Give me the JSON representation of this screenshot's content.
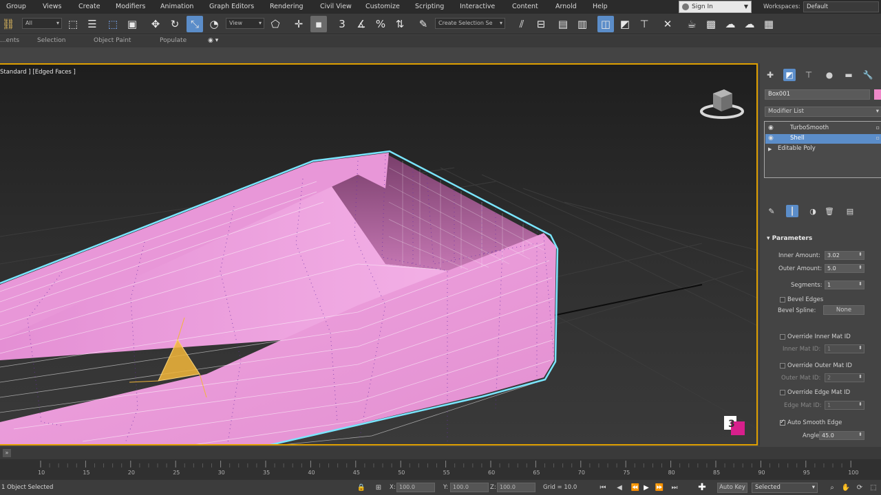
{
  "menu": {
    "items": [
      "Group",
      "Views",
      "Create",
      "Modifiers",
      "Animation",
      "Graph Editors",
      "Rendering",
      "Civil View",
      "Customize",
      "Scripting",
      "Interactive",
      "Content",
      "Arnold",
      "Help"
    ],
    "signin": "Sign In",
    "workspaces_label": "Workspaces:",
    "workspace_value": "Default"
  },
  "toolbar": {
    "filter_dropdown": "All",
    "ref_coord_dropdown": "View",
    "snap_label": "3",
    "named_selection": "Create Selection Se"
  },
  "ribbon": {
    "tabs": [
      "...ents",
      "Selection",
      "Object Paint",
      "Populate"
    ]
  },
  "viewport": {
    "label": "Standard ] [Edged Faces ]"
  },
  "command_panel": {
    "object_name": "Box001",
    "object_color": "#ee88c8",
    "modifier_list": "Modifier List",
    "stack": [
      {
        "label": "TurboSmooth",
        "selected": false
      },
      {
        "label": "Shell",
        "selected": true
      },
      {
        "label": "Editable Poly",
        "selected": false
      }
    ],
    "rollout_title": "Parameters",
    "inner_amount_label": "Inner Amount:",
    "inner_amount_value": "3.02",
    "outer_amount_label": "Outer Amount:",
    "outer_amount_value": "5.0",
    "segments_label": "Segments:",
    "segments_value": "1",
    "bevel_edges_label": "Bevel Edges",
    "bevel_spline_label": "Bevel Spline:",
    "bevel_spline_value": "None",
    "override_inner_label": "Override Inner Mat ID",
    "inner_mat_id_label": "Inner Mat ID:",
    "inner_mat_id_value": "1",
    "override_outer_label": "Override Outer Mat ID",
    "outer_mat_id_label": "Outer Mat ID:",
    "outer_mat_id_value": "2",
    "override_edge_label": "Override Edge Mat ID",
    "edge_mat_id_label": "Edge Mat ID:",
    "edge_mat_id_value": "1",
    "auto_smooth_label": "Auto Smooth Edge",
    "auto_smooth_checked": true,
    "angle_label": "Angle:",
    "angle_value": "45.0"
  },
  "timeline": {
    "ticks": [
      "10",
      "15",
      "20",
      "25",
      "30",
      "35",
      "40",
      "45",
      "50",
      "55",
      "60",
      "65",
      "70",
      "75",
      "80",
      "85",
      "90",
      "95",
      "100"
    ]
  },
  "status": {
    "selection": "1 Object Selected",
    "x_label": "X:",
    "x_value": "100.0",
    "y_label": "Y:",
    "y_value": "100.0",
    "z_label": "Z:",
    "z_value": "100.0",
    "grid": "Grid = 10.0",
    "autokey": "Auto Key",
    "key_mode": "Selected"
  }
}
